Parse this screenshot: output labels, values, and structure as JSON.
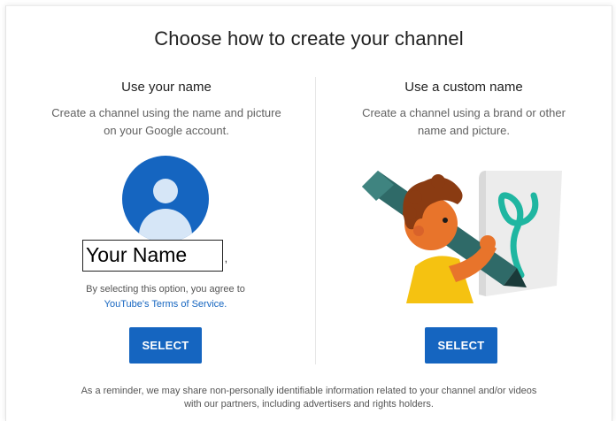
{
  "dialog": {
    "title": "Choose how to create your channel"
  },
  "left_option": {
    "title": "Use your name",
    "description_line1": "Create a channel using the name and picture",
    "description_line2": "on your Google account.",
    "name_value": "Your Name",
    "agree_text": "By selecting this option, you agree to",
    "terms_link": "YouTube's Terms of Service.",
    "select_label": "SELECT"
  },
  "right_option": {
    "title": "Use a custom name",
    "description_line1": "Create a channel using a brand or other",
    "description_line2": "name and picture.",
    "select_label": "SELECT"
  },
  "footer": {
    "line1": "As a reminder, we may share non-personally identifiable information related to your channel and/or videos",
    "line2": "with our partners, including advertisers and rights holders."
  },
  "colors": {
    "accent": "#1565c0",
    "title_text": "#212121",
    "secondary_text": "#616161"
  },
  "icons": {
    "avatar": "default-profile-avatar-icon",
    "illustration": "custom-name-brand-illustration"
  }
}
